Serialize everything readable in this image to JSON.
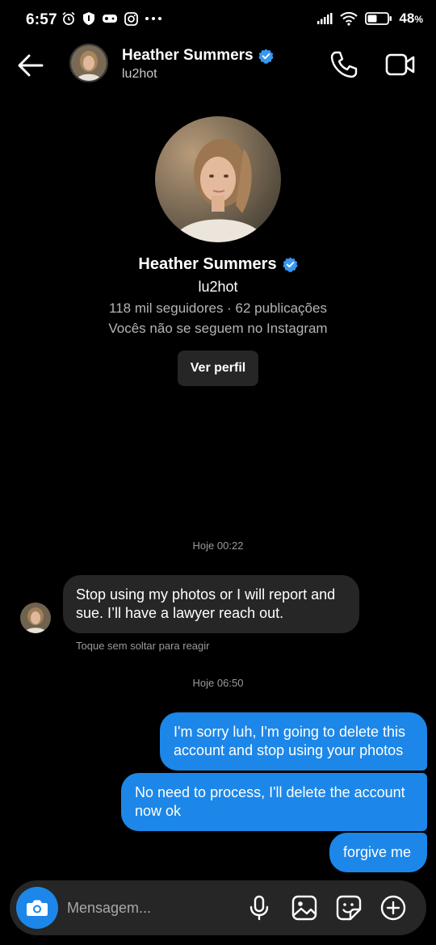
{
  "status_bar": {
    "time": "6:57",
    "battery_percent": "48",
    "battery_symbol": "%",
    "battery_level": 0.48
  },
  "header": {
    "name": "Heather Summers",
    "username": "lu2hot",
    "verified": true
  },
  "profile": {
    "name": "Heather Summers",
    "username": "lu2hot",
    "stats": "118 mil seguidores · 62 publicações",
    "follow_status": "Vocês não se seguem no Instagram",
    "view_profile_label": "Ver perfil"
  },
  "messages": {
    "timestamp_1": "Hoje 00:22",
    "incoming_1": "Stop using my photos or I will report and sue. I’ll have a lawyer reach out.",
    "react_hint": "Toque sem soltar para reagir",
    "timestamp_2": "Hoje 06:50",
    "outgoing_1": "I'm sorry luh, I'm going to delete this account and stop using your photos",
    "outgoing_2": "No need to process, I'll delete the account now ok",
    "outgoing_3": "forgive me"
  },
  "composer": {
    "placeholder": "Mensagem..."
  },
  "colors": {
    "background": "#000000",
    "bubble_outgoing": "#1c87e8",
    "bubble_incoming": "#262626",
    "verified_badge": "#3897f0"
  },
  "icons": [
    "back-arrow-icon",
    "phone-icon",
    "video-camera-icon",
    "verified-badge-icon",
    "camera-icon",
    "microphone-icon",
    "gallery-icon",
    "sticker-icon",
    "plus-icon"
  ]
}
